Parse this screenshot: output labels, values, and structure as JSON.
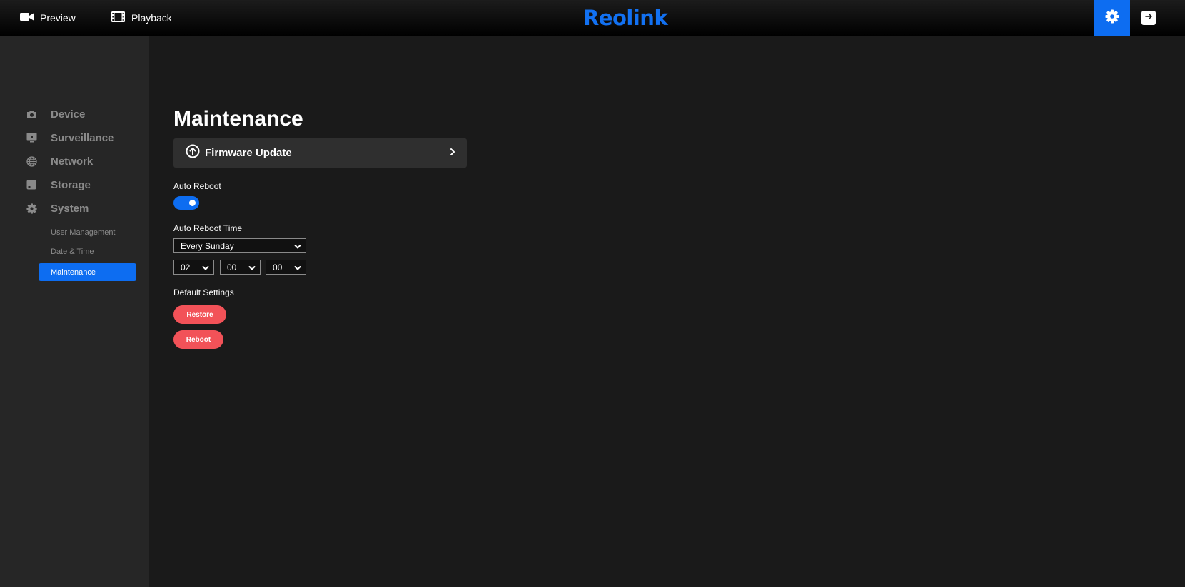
{
  "topbar": {
    "preview_label": "Preview",
    "playback_label": "Playback",
    "brand": "Reolink",
    "settings_icon": "gear-icon",
    "logout_icon": "logout-icon"
  },
  "sidebar": {
    "items": [
      {
        "label": "Device",
        "icon": "camera-icon"
      },
      {
        "label": "Surveillance",
        "icon": "monitor-icon"
      },
      {
        "label": "Network",
        "icon": "globe-icon"
      },
      {
        "label": "Storage",
        "icon": "hdd-icon"
      },
      {
        "label": "System",
        "icon": "gear-icon"
      }
    ],
    "sub_items": [
      {
        "label": "User Management",
        "active": false
      },
      {
        "label": "Date & Time",
        "active": false
      },
      {
        "label": "Maintenance",
        "active": true
      }
    ]
  },
  "main": {
    "title": "Maintenance",
    "firmware_update_label": "Firmware Update",
    "auto_reboot_label": "Auto Reboot",
    "auto_reboot_enabled": true,
    "auto_reboot_time_label": "Auto Reboot Time",
    "day_value": "Every Sunday",
    "hour_value": "02",
    "minute_value": "00",
    "second_value": "00",
    "default_settings_label": "Default Settings",
    "restore_label": "Restore",
    "reboot_label": "Reboot"
  },
  "colors": {
    "accent": "#0d6df1",
    "brand": "#1271f2",
    "danger": "#f25258",
    "sidebar_bg": "#262626",
    "main_bg": "#1a1a1a"
  }
}
